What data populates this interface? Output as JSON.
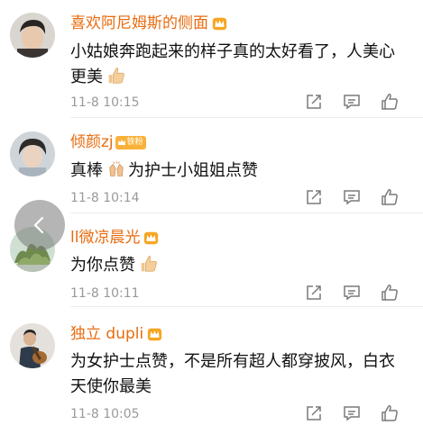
{
  "comments": [
    {
      "username": "喜欢阿尼姆斯的侧面",
      "badge": "",
      "text": "小姑娘奔跑起来的样子真的太好看了，人美心更美",
      "emoji": "thumbs-up",
      "time": "11-8 10:15",
      "avatar": "boy-portrait-avatar"
    },
    {
      "username": "倾颜zj",
      "badge": "铁粉",
      "text": "真棒",
      "text_after": "为护士小姐姐点赞",
      "emoji": "clapping-hands",
      "time": "11-8 10:14",
      "avatar": "girl-portrait-avatar"
    },
    {
      "username": "ll微凉晨光",
      "badge": "",
      "text": "为你点赞",
      "emoji": "thumbs-up",
      "time": "11-8 10:11",
      "avatar": "food-photo-avatar"
    },
    {
      "username": "独立 dupli",
      "badge": "",
      "text": "为女护士点赞，不是所有超人都穿披风，白衣天使你最美",
      "emoji": "",
      "time": "11-8 10:05",
      "avatar": "guitar-man-avatar"
    }
  ],
  "colors": {
    "username": "#e86b0f",
    "time": "#9a9a9a",
    "icon": "#7a7a7a",
    "badge": "#f8b23a"
  },
  "icons": {
    "repost": "share-icon",
    "comment": "comment-icon",
    "like": "like-icon",
    "back": "chevron-left-icon",
    "vip": "crown-icon"
  }
}
